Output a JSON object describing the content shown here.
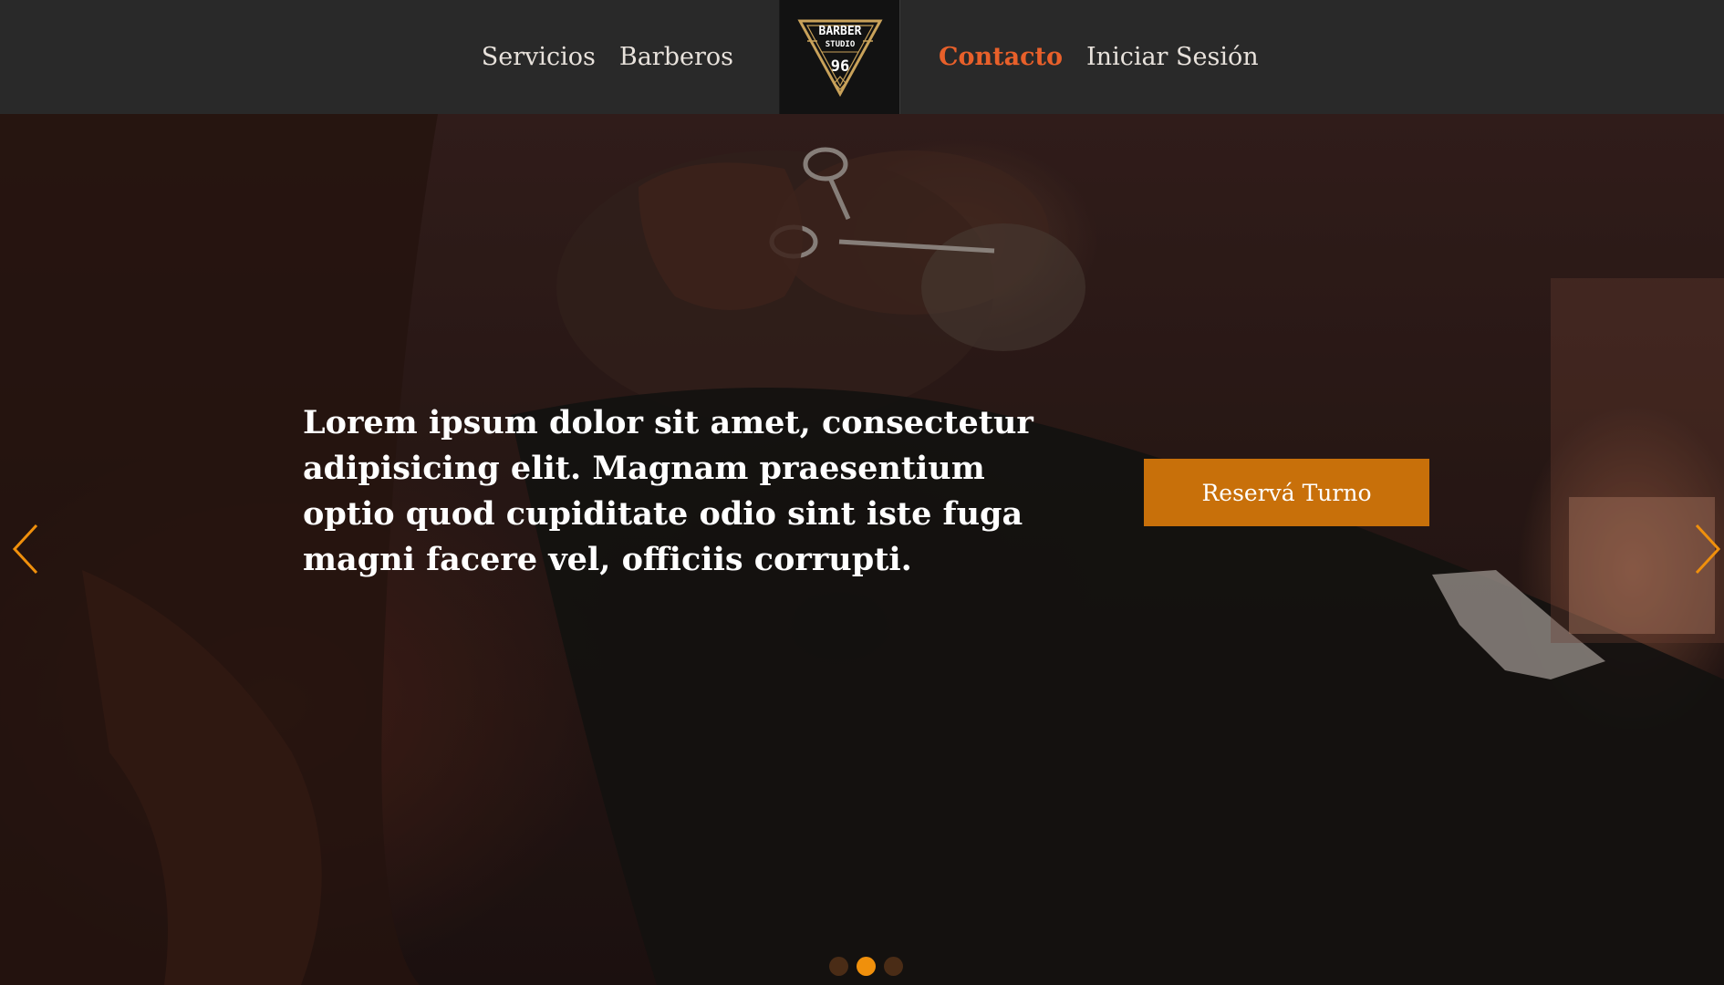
{
  "nav": {
    "left_links": [
      {
        "label": "Servicios"
      },
      {
        "label": "Barberos"
      }
    ],
    "right_links": [
      {
        "label": "Contacto",
        "active": true
      },
      {
        "label": "Iniciar Sesión"
      }
    ],
    "logo": {
      "line1": "BARBER",
      "line2": "STUDIO",
      "number": "96"
    }
  },
  "hero": {
    "text": "Lorem ipsum dolor sit amet, consectetur adipisicing elit. Magnam praesentium optio quod cupiditate odio sint iste fuga magni facere vel, officiis corrupti.",
    "cta_label": "Reservá Turno",
    "slides": 3,
    "active_slide": 2
  },
  "colors": {
    "accent": "#c8700a",
    "active_link": "#e8602a",
    "arrow": "#f0900c",
    "navbar_bg": "#292929",
    "logo_gold": "#c9a25a"
  },
  "icons": {
    "prev": "chevron-left-icon",
    "next": "chevron-right-icon"
  }
}
